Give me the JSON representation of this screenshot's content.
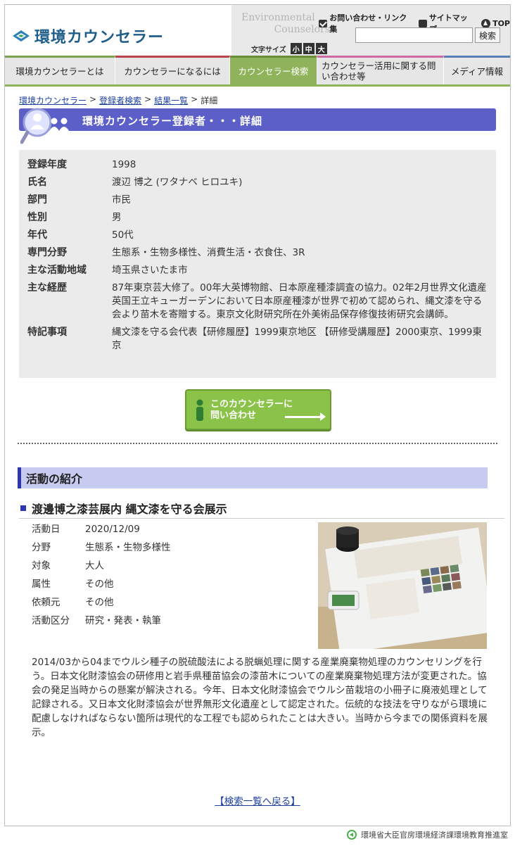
{
  "header": {
    "logo_text": "環境カウンセラー",
    "env_line1": "Environmental",
    "env_line2": "Counselors",
    "util_links": {
      "contact": "お問い合わせ・リンク集",
      "sitemap": "サイトマップ",
      "top": "TOP"
    },
    "search": {
      "value": "",
      "placeholder": "",
      "button": "検索"
    },
    "fontsize": {
      "label": "文字サイズ",
      "small": "小",
      "medium": "中",
      "large": "大"
    }
  },
  "nav": {
    "items": [
      {
        "label": "環境カウンセラーとは"
      },
      {
        "label": "カウンセラーになるには"
      },
      {
        "label": "カウンセラー検索"
      },
      {
        "label": "カウンセラー活用に関する問い合わせ等"
      },
      {
        "label": "メディア情報"
      }
    ]
  },
  "breadcrumb": {
    "home": "環境カウンセラー",
    "search": "登録者検索",
    "results": "結果一覧",
    "current": "詳細",
    "sep": ">"
  },
  "page_title": "環境カウンセラー登録者・・・詳細",
  "detail": {
    "rows": [
      {
        "label": "登録年度",
        "value": "1998"
      },
      {
        "label": "氏名",
        "value": "渡辺 博之 (ワタナベ ヒロユキ)"
      },
      {
        "label": "部門",
        "value": "市民"
      },
      {
        "label": "性別",
        "value": "男"
      },
      {
        "label": "年代",
        "value": "50代"
      },
      {
        "label": "専門分野",
        "value": "生態系・生物多様性、消費生活・衣食住、3R"
      },
      {
        "label": "主な活動地域",
        "value": "埼玉県さいたま市"
      },
      {
        "label": "主な経歴",
        "value": "87年東京芸大修了。00年大英博物館、日本原産種漆調査の協力。02年2月世界文化遺産英国王立キューガーデンにおいて日本原産種漆が世界で初めて認められ、縄文漆を守る会より苗木を寄贈する。東京文化財研究所在外美術品保存修復技術研究会講師。"
      },
      {
        "label": "特記事項",
        "value": "縄文漆を守る会代表【研修履歴】1999東京地区 【研修受講履歴】2000東京、1999東京"
      }
    ]
  },
  "contact_button": {
    "line1": "このカウンセラーに",
    "line2": "問い合わせ"
  },
  "activity": {
    "section_title": "活動の紹介",
    "title": "渡邊博之漆芸展内 縄文漆を守る会展示",
    "info": [
      {
        "label": "活動日",
        "value": "2020/12/09"
      },
      {
        "label": "分野",
        "value": "生態系・生物多様性"
      },
      {
        "label": "対象",
        "value": "大人"
      },
      {
        "label": "属性",
        "value": "その他"
      },
      {
        "label": "依頼元",
        "value": "その他"
      },
      {
        "label": "活動区分",
        "value": "研究・発表・執筆"
      }
    ],
    "description": "2014/03から04までウルシ種子の脱硫酸法による脱蝋処理に関する産業廃棄物処理のカウンセリングを行う。日本文化財漆協会の研修用と岩手県種苗協会の漆苗木についての産業廃棄物処理方法が変更された。協会の発足当時からの懸案が解決される。今年、日本文化財漆協会でウルシ苗栽培の小冊子に廃液処理として記録される。又日本文化財漆協会が世界無形文化遺産として認定された。伝統的な技法を守りながら環境に配慮しなければならない箇所は現代的な工程でも認められたことは大きい。当時から今までの関係資料を展示。"
  },
  "back_link": "【検索一覧へ戻る】",
  "footer": "環境省大臣官房環境経済課環境教育推進室",
  "colors": {
    "brand_blue": "#1f5e8a",
    "title_bar": "#5c5fc8",
    "nav_active": "#8fb35a",
    "contact_green": "#8bc34a",
    "activity_header_bg": "#c7cbf0",
    "activity_accent": "#2e35b0"
  }
}
